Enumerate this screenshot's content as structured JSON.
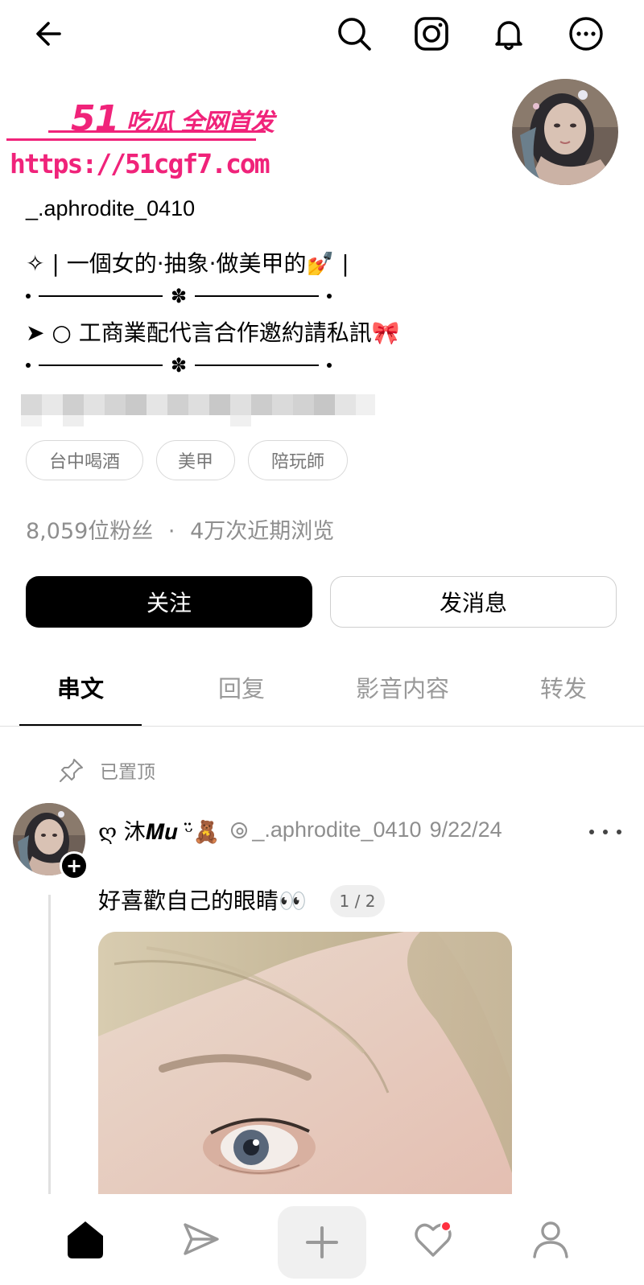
{
  "header": {
    "back_icon": "arrow-left-icon",
    "icons": [
      "search-icon",
      "instagram-icon",
      "bell-icon",
      "more-circle-icon"
    ]
  },
  "watermark": {
    "line1_number": "51",
    "line1_text": "吃瓜 全网首发",
    "url": "https://51cgf7.com"
  },
  "profile": {
    "username": "_.aphrodite_0410",
    "bio_line1": "✧ | 一個女的·抽象·做美甲的💅 |",
    "bio_line3": "➤ ○ 工商業配代言合作邀約請私訊🎀",
    "divider_symbol": "✽",
    "tags": [
      "台中喝酒",
      "美甲",
      "陪玩師"
    ],
    "stats_followers": "8,059位粉丝",
    "stats_separator": "·",
    "stats_views": "4万次近期浏览"
  },
  "actions": {
    "follow_label": "关注",
    "message_label": "发消息"
  },
  "tabs": [
    {
      "label": "串文",
      "active": true
    },
    {
      "label": "回复",
      "active": false
    },
    {
      "label": "影音内容",
      "active": false
    },
    {
      "label": "转发",
      "active": false
    }
  ],
  "post": {
    "pinned_label": "已置顶",
    "display_name": "ღ 沐𝑴𝒖 ᵕ̈🧸",
    "handle": "_.aphrodite_0410",
    "date": "9/22/24",
    "text": "好喜歡自己的眼睛👀",
    "counter": "1 / 2"
  },
  "bottom_nav": {
    "items": [
      "home-icon",
      "send-icon",
      "compose-icon",
      "activity-icon",
      "profile-icon"
    ],
    "activity_dot_color": "#ff3040"
  },
  "colors": {
    "accent_watermark": "#f0237a",
    "muted_text": "#8e8e8e"
  }
}
